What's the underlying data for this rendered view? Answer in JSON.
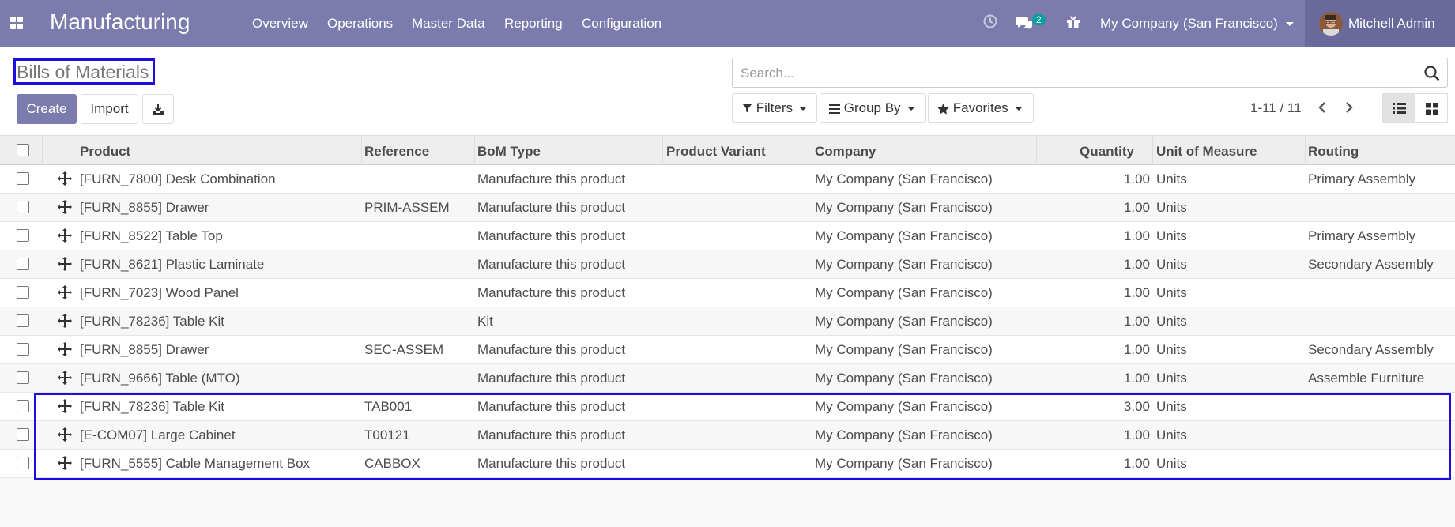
{
  "app": {
    "name": "Manufacturing",
    "menu": [
      "Overview",
      "Operations",
      "Master Data",
      "Reporting",
      "Configuration"
    ],
    "messages_count": "2",
    "company": "My Company (San Francisco)",
    "user": "Mitchell Admin"
  },
  "page": {
    "title": "Bills of Materials",
    "create_label": "Create",
    "import_label": "Import",
    "search_placeholder": "Search...",
    "filters_label": "Filters",
    "groupby_label": "Group By",
    "favorites_label": "Favorites",
    "pager": "1-11 / 11"
  },
  "table": {
    "columns": [
      "Product",
      "Reference",
      "BoM Type",
      "Product Variant",
      "Company",
      "Quantity",
      "Unit of Measure",
      "Routing"
    ],
    "rows": [
      {
        "product": "[FURN_7800] Desk Combination",
        "reference": "",
        "bom_type": "Manufacture this product",
        "variant": "",
        "company": "My Company (San Francisco)",
        "qty": "1.00",
        "uom": "Units",
        "routing": "Primary Assembly"
      },
      {
        "product": "[FURN_8855] Drawer",
        "reference": "PRIM-ASSEM",
        "bom_type": "Manufacture this product",
        "variant": "",
        "company": "My Company (San Francisco)",
        "qty": "1.00",
        "uom": "Units",
        "routing": ""
      },
      {
        "product": "[FURN_8522] Table Top",
        "reference": "",
        "bom_type": "Manufacture this product",
        "variant": "",
        "company": "My Company (San Francisco)",
        "qty": "1.00",
        "uom": "Units",
        "routing": "Primary Assembly"
      },
      {
        "product": "[FURN_8621] Plastic Laminate",
        "reference": "",
        "bom_type": "Manufacture this product",
        "variant": "",
        "company": "My Company (San Francisco)",
        "qty": "1.00",
        "uom": "Units",
        "routing": "Secondary Assembly"
      },
      {
        "product": "[FURN_7023] Wood Panel",
        "reference": "",
        "bom_type": "Manufacture this product",
        "variant": "",
        "company": "My Company (San Francisco)",
        "qty": "1.00",
        "uom": "Units",
        "routing": ""
      },
      {
        "product": "[FURN_78236] Table Kit",
        "reference": "",
        "bom_type": "Kit",
        "variant": "",
        "company": "My Company (San Francisco)",
        "qty": "1.00",
        "uom": "Units",
        "routing": ""
      },
      {
        "product": "[FURN_8855] Drawer",
        "reference": "SEC-ASSEM",
        "bom_type": "Manufacture this product",
        "variant": "",
        "company": "My Company (San Francisco)",
        "qty": "1.00",
        "uom": "Units",
        "routing": "Secondary Assembly"
      },
      {
        "product": "[FURN_9666] Table (MTO)",
        "reference": "",
        "bom_type": "Manufacture this product",
        "variant": "",
        "company": "My Company (San Francisco)",
        "qty": "1.00",
        "uom": "Units",
        "routing": "Assemble Furniture"
      },
      {
        "product": "[FURN_78236] Table Kit",
        "reference": "TAB001",
        "bom_type": "Manufacture this product",
        "variant": "",
        "company": "My Company (San Francisco)",
        "qty": "3.00",
        "uom": "Units",
        "routing": ""
      },
      {
        "product": "[E-COM07] Large Cabinet",
        "reference": "T00121",
        "bom_type": "Manufacture this product",
        "variant": "",
        "company": "My Company (San Francisco)",
        "qty": "1.00",
        "uom": "Units",
        "routing": ""
      },
      {
        "product": "[FURN_5555] Cable Management Box",
        "reference": "CABBOX",
        "bom_type": "Manufacture this product",
        "variant": "",
        "company": "My Company (San Francisco)",
        "qty": "1.00",
        "uom": "Units",
        "routing": ""
      }
    ]
  },
  "colors": {
    "brand": "#7c7bad",
    "badge": "#00a09d",
    "annotation": "#1a0fe0"
  }
}
